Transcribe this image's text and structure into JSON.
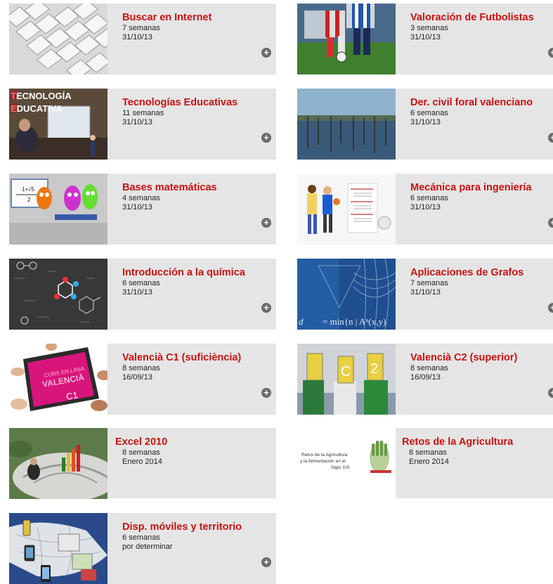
{
  "courses": [
    {
      "title": "Buscar en Internet",
      "duration": "7 semanas",
      "date": "31/10/13",
      "image": "keyboard-photo"
    },
    {
      "title": "Valoración de Futbolistas",
      "duration": "3 semanas",
      "date": "31/10/13",
      "image": "football-players-photo"
    },
    {
      "title": "Tecnologías Educativas",
      "duration": "11 semanas",
      "date": "31/10/13",
      "image": "classroom-whiteboard-photo",
      "image_text": [
        "TECNOLOGÍA",
        "EDUCATIVA"
      ]
    },
    {
      "title": "Der. civil foral valenciano",
      "duration": "6 semanas",
      "date": "31/10/13",
      "image": "lake-landscape-photo"
    },
    {
      "title": "Bases matemáticas",
      "duration": "4 semanas",
      "date": "31/10/13",
      "image": "monsters-blackboard-illustration"
    },
    {
      "title": "Mecánica para ingeniería",
      "duration": "6 semanas",
      "date": "31/10/13",
      "image": "basketball-players-illustration"
    },
    {
      "title": "Introducción a la química",
      "duration": "6 semanas",
      "date": "31/10/13",
      "image": "chemistry-blackboard-illustration"
    },
    {
      "title": "Aplicaciones de Grafos",
      "duration": "7 semanas",
      "date": "31/10/13",
      "image": "graph-theory-blue-illustration",
      "image_text": "d",
      "image_formula": "= min{n | Aⁿ(x,y)"
    },
    {
      "title": "Valencià C1 (suficiència)",
      "duration": "8 semanas",
      "date": "16/09/13",
      "image": "tablet-hands-photo",
      "image_text": [
        "CURS EN LÍNIA",
        "VALENCIÀ",
        "C1"
      ]
    },
    {
      "title": "Valencià C2 (superior)",
      "duration": "8 semanas",
      "date": "16/09/13",
      "image": "people-with-signs-photo",
      "image_text": [
        "C",
        "2"
      ]
    },
    {
      "title": "Excel 2010",
      "duration": "8 semanas",
      "date": "Enero 2014",
      "image": "outdoor-chart-photo"
    },
    {
      "title": "Retos de la Agricultura",
      "duration": "8 semanas",
      "date": "Enero 2014",
      "image": "agriculture-logo",
      "image_text": [
        "Retos de la Agricultura",
        "y la Alimentación en el",
        "Siglo XXI"
      ]
    },
    {
      "title": "Disp. móviles y territorio",
      "duration": "6 semanas",
      "date": "por determinar",
      "image": "mobile-devices-map-illustration"
    }
  ],
  "more_icon": "plus-circle-icon",
  "colors": {
    "title": "#cc1111",
    "card_background": "#e5e5e5",
    "icon": "#6a6a6a"
  }
}
